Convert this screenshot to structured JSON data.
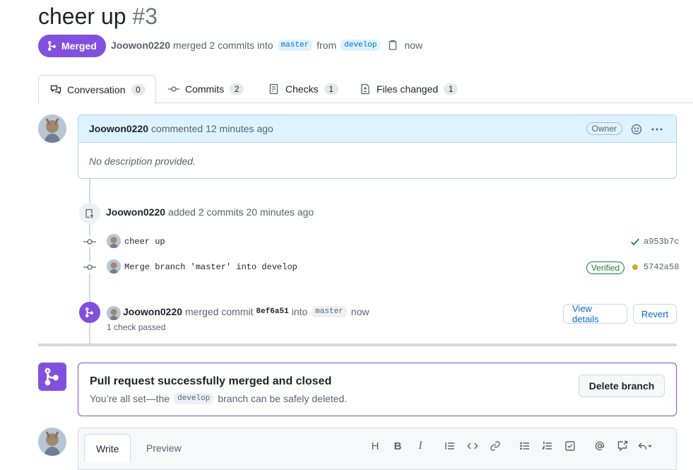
{
  "pr": {
    "title": "cheer up",
    "number": "#3",
    "state": "Merged",
    "author": "Joowon0220",
    "merge_text": "merged 2 commits into",
    "base_branch": "master",
    "from_text": "from",
    "head_branch": "develop",
    "time": "now"
  },
  "tabs": [
    {
      "label": "Conversation",
      "count": "0",
      "icon": "conversation-icon"
    },
    {
      "label": "Commits",
      "count": "2",
      "icon": "commit-icon"
    },
    {
      "label": "Checks",
      "count": "1",
      "icon": "checklist-icon"
    },
    {
      "label": "Files changed",
      "count": "1",
      "icon": "file-diff-icon"
    }
  ],
  "comment": {
    "author": "Joowon0220",
    "action": "commented 12 minutes ago",
    "badge": "Owner",
    "body": "No description provided."
  },
  "commits_event": {
    "author": "Joowon0220",
    "action": "added 2 commits 20 minutes ago",
    "commits": [
      {
        "message": "cheer up",
        "sha": "a953b7c",
        "verified": "",
        "status": "success"
      },
      {
        "message": "Merge branch 'master' into develop",
        "sha": "5742a58",
        "verified": "Verified",
        "status": "pending"
      }
    ]
  },
  "merge_event": {
    "author": "Joowon0220",
    "action": "merged commit",
    "commit": "8ef6a51",
    "into": "into",
    "branch": "master",
    "time": "now",
    "checks": "1 check passed",
    "view_details": "View details",
    "revert": "Revert"
  },
  "merged_box": {
    "title": "Pull request successfully merged and closed",
    "desc_pre": "You’re all set—the",
    "branch": "develop",
    "desc_post": "branch can be safely deleted.",
    "delete_button": "Delete branch"
  },
  "editor": {
    "write_tab": "Write",
    "preview_tab": "Preview",
    "toolbar": [
      "heading-icon",
      "bold-icon",
      "italic-icon",
      "quote-icon",
      "code-icon",
      "link-icon",
      "unordered-list-icon",
      "ordered-list-icon",
      "task-list-icon",
      "mention-icon",
      "reference-icon",
      "reply-icon"
    ]
  },
  "colors": {
    "merged": "#8250df",
    "link": "#0969da",
    "success": "#1a7f37",
    "pending": "#d4a72c"
  }
}
